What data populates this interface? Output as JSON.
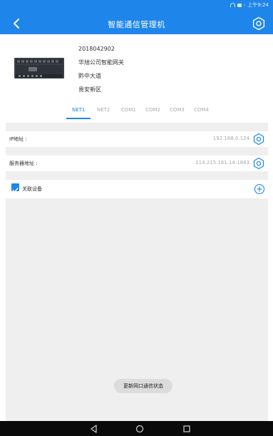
{
  "status_bar": {
    "time": "上午9:24",
    "icons": [
      "wifi-icon",
      "battery-icon",
      "arrow-icon"
    ]
  },
  "app_bar": {
    "title": "智能通信管理机",
    "back_icon": "chevron-left-icon",
    "settings_icon": "gear-icon"
  },
  "device": {
    "serial": "2018042902",
    "gateway_name": "华旭公司智能网关",
    "road": "黔中大道",
    "district": "贵安新区"
  },
  "tabs": [
    {
      "label": "NET1",
      "active": true
    },
    {
      "label": "NET2",
      "active": false
    },
    {
      "label": "COM1",
      "active": false
    },
    {
      "label": "COM2",
      "active": false
    },
    {
      "label": "COM3",
      "active": false
    },
    {
      "label": "COM4",
      "active": false
    }
  ],
  "ip_row": {
    "label": "IP地址 :",
    "value": "192.168.0.124"
  },
  "server_row": {
    "label": "服务器地址 :",
    "value": "114.215.181.14:1883"
  },
  "linked_devices": {
    "label": "关联设备",
    "checked": true
  },
  "update_button": "更新网口通信状态",
  "colors": {
    "accent": "#1e86ea",
    "background_gray": "#efeff0",
    "nav_bar": "#0a0a0a"
  }
}
